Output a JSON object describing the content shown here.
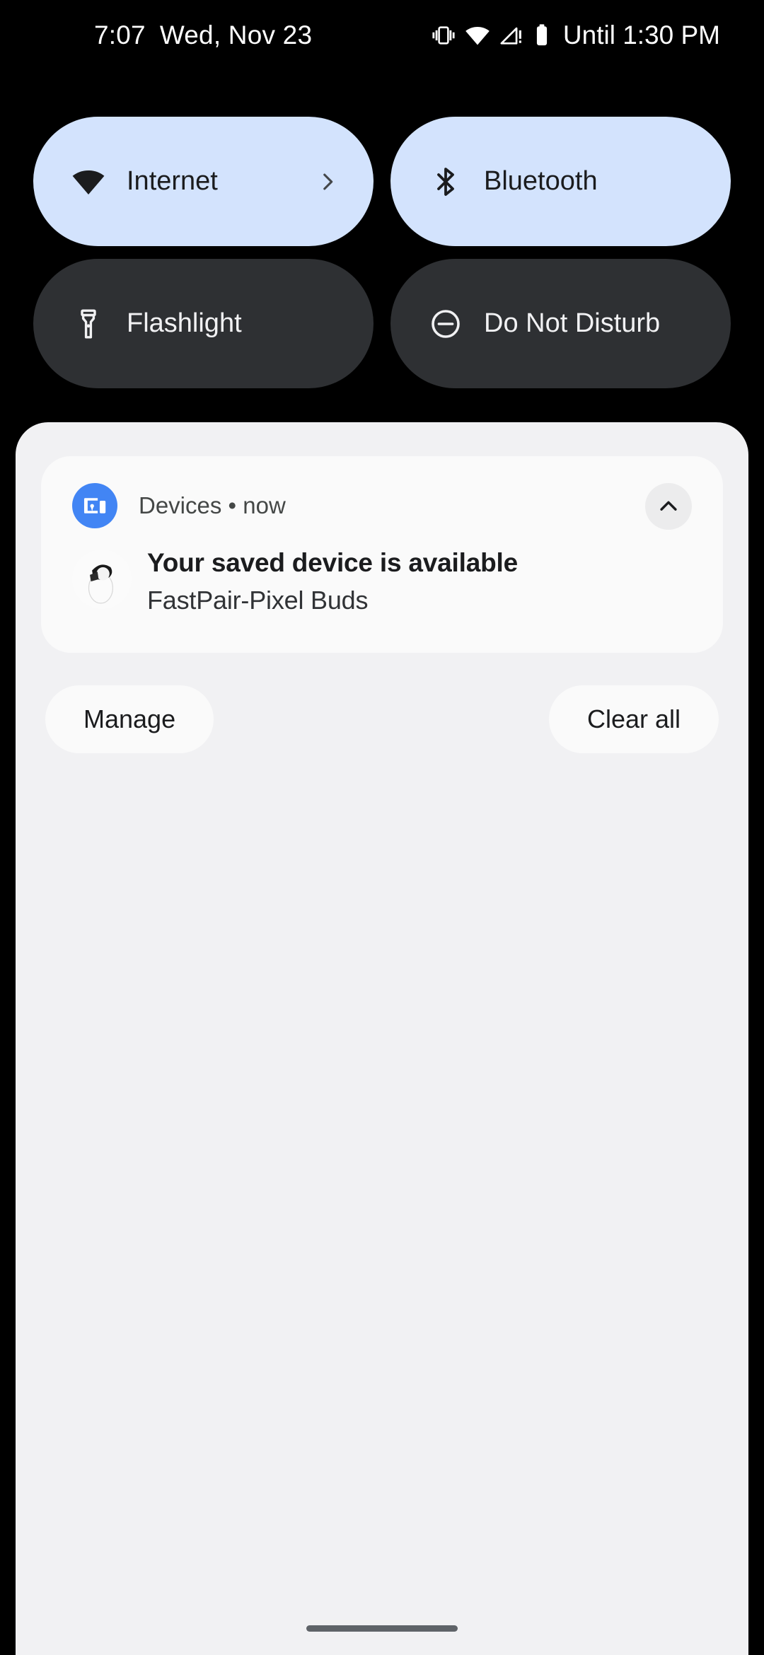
{
  "statusbar": {
    "clock": "7:07",
    "date": "Wed, Nov 23",
    "until_label": "Until 1:30 PM",
    "icons": [
      "vibrate-icon",
      "wifi-icon",
      "signal-warning-icon",
      "battery-icon"
    ]
  },
  "quick_settings": {
    "tiles": [
      {
        "label": "Internet",
        "icon": "wifi-icon",
        "state": "on",
        "has_chevron": true
      },
      {
        "label": "Bluetooth",
        "icon": "bluetooth-icon",
        "state": "on",
        "has_chevron": false
      },
      {
        "label": "Flashlight",
        "icon": "flashlight-icon",
        "state": "off",
        "has_chevron": false
      },
      {
        "label": "Do Not Disturb",
        "icon": "dnd-icon",
        "state": "off",
        "has_chevron": false
      }
    ]
  },
  "notification": {
    "app_name": "Devices",
    "separator": "•",
    "time": "now",
    "header_text": "Devices • now",
    "title": "Your saved device is available",
    "subtitle": "FastPair-Pixel Buds",
    "app_icon": "devices-cast-icon",
    "device_image": "pixel-buds-earbud",
    "collapse_icon": "chevron-up-icon"
  },
  "footer": {
    "manage_label": "Manage",
    "clear_all_label": "Clear all"
  },
  "colors": {
    "background": "#000000",
    "tile_on_bg": "#d3e3fd",
    "tile_off_bg": "#2e3033",
    "shade_bg": "#f1f1f3",
    "card_bg": "#fafafa",
    "app_badge": "#4285f4",
    "text_primary": "#1b1c1e",
    "text_secondary": "#444746"
  }
}
